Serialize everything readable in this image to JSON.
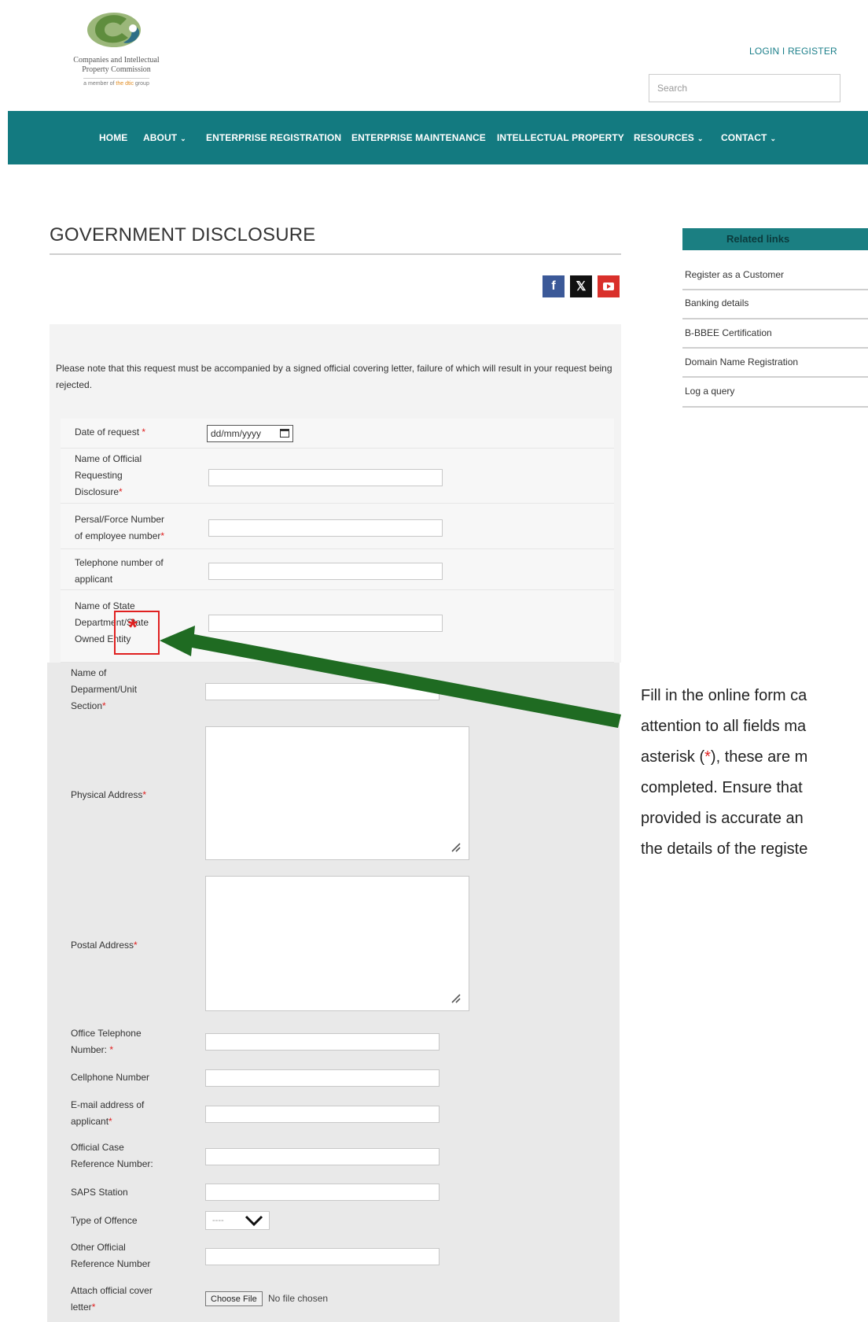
{
  "header": {
    "logo_line1": "Companies and Intellectual",
    "logo_line2": "Property Commission",
    "logo_sub_prefix": "a member of ",
    "logo_sub_accent": "the dtic",
    "logo_sub_suffix": " group",
    "login_label": "LOGIN I REGISTER",
    "search_placeholder": "Search"
  },
  "nav": {
    "items": [
      {
        "label": "HOME"
      },
      {
        "label": "ABOUT"
      },
      {
        "label": "ENTERPRISE REGISTRATION"
      },
      {
        "label": "ENTERPRISE MAINTENANCE"
      },
      {
        "label": "INTELLECTUAL PROPERTY"
      },
      {
        "label": "RESOURCES"
      },
      {
        "label": "CONTACT"
      }
    ]
  },
  "page": {
    "title": "GOVERNMENT DISCLOSURE",
    "notice": "Please note that this request must be accompanied by a signed official covering letter, failure of which will result in your request being rejected."
  },
  "social": {
    "facebook": "f",
    "x": "𝕏"
  },
  "form": {
    "date_label": "Date of request",
    "date_placeholder": "dd/mm/yyyy",
    "official_name_label_1": "Name of Official",
    "official_name_label_2": "Requesting",
    "official_name_label_3": "Disclosure",
    "persal_label_1": "Persal/Force Number",
    "persal_label_2": "of employee number",
    "telephone_label_1": "Telephone number of",
    "telephone_label_2": "applicant",
    "state_dept_label_1": "Name of State",
    "state_dept_label_2": "Department/State",
    "state_dept_label_3": "Owned Entity",
    "unit_label_1": "Name of",
    "unit_label_2": "Deparment/Unit",
    "unit_label_3": "Section",
    "physical_label": "Physical Address",
    "postal_label": "Postal Address",
    "office_tel_label_1": "Office Telephone",
    "office_tel_label_2": "Number: ",
    "cellphone_label": "Cellphone Number",
    "email_label_1": "E-mail address of",
    "email_label_2": "applicant",
    "case_ref_label_1": "Official Case",
    "case_ref_label_2": "Reference Number:",
    "saps_label": "SAPS Station",
    "offence_label": "Type of Offence",
    "offence_selected": "----",
    "other_ref_label_1": "Other Official",
    "other_ref_label_2": "Reference Number",
    "attach_label_1": "Attach official cover",
    "attach_label_2": "letter",
    "file_button": "Choose File",
    "file_status": "No file chosen",
    "required_mark": "*"
  },
  "annotation": {
    "star": "*",
    "line1": "Fill in the online form ca",
    "line2": "attention to all fields ma",
    "line3_pre": "asterisk (",
    "line3_star": "*",
    "line3_post": "), these are m",
    "line4": "completed. Ensure that",
    "line5": "provided is accurate an",
    "line6": "the details of the registe"
  },
  "related_links": {
    "heading": "Related links",
    "items": [
      {
        "label": "Register as a Customer"
      },
      {
        "label": "Banking details"
      },
      {
        "label": "B-BBEE Certification"
      },
      {
        "label": "Domain Name Registration"
      },
      {
        "label": "Log a query"
      }
    ]
  },
  "colors": {
    "nav_bg": "#137a80",
    "required": "#e02020",
    "arrow": "#1f6b22",
    "related_head": "#1b7f82"
  }
}
